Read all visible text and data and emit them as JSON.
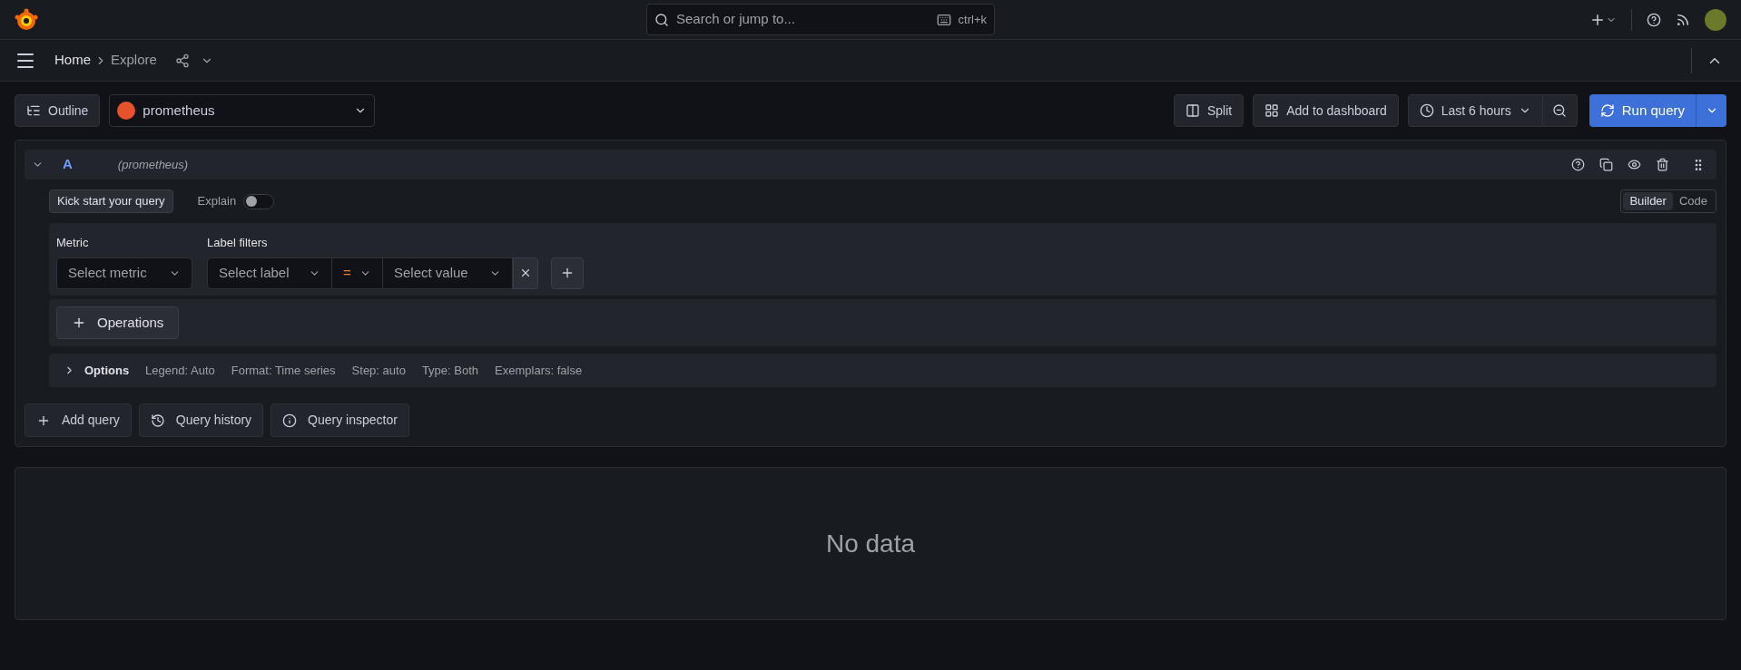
{
  "top_bar": {
    "search": {
      "placeholder": "Search or jump to..."
    },
    "shortcut": "ctrl+k"
  },
  "breadcrumbs": [
    {
      "label": "Home",
      "current": false
    },
    {
      "label": "Explore",
      "current": true
    }
  ],
  "toolbar": {
    "outline": "Outline",
    "datasource": "prometheus",
    "split": "Split",
    "add_to_dashboard": "Add to dashboard",
    "time_range": "Last 6 hours",
    "run_query": "Run query"
  },
  "query": {
    "ref": "A",
    "datasource": "(prometheus)",
    "expanded": true,
    "kick_start": "Kick start your query",
    "explain": {
      "label": "Explain",
      "on": false
    },
    "modes": [
      {
        "label": "Builder",
        "selected": true
      },
      {
        "label": "Code",
        "selected": false
      }
    ],
    "metric": {
      "label": "Metric",
      "placeholder": "Select metric"
    },
    "label_filters": {
      "label": "Label filters",
      "label_placeholder": "Select label",
      "operator": "=",
      "value_placeholder": "Select value"
    },
    "operations": "Operations",
    "options": {
      "title": "Options",
      "expanded": false,
      "items": [
        "Legend: Auto",
        "Format: Time series",
        "Step: auto",
        "Type: Both",
        "Exemplars: false"
      ]
    }
  },
  "actions": [
    {
      "kind": "add",
      "label": "Add query"
    },
    {
      "kind": "history",
      "label": "Query history"
    },
    {
      "kind": "inspector",
      "label": "Query inspector"
    }
  ],
  "result": {
    "message": "No data"
  }
}
